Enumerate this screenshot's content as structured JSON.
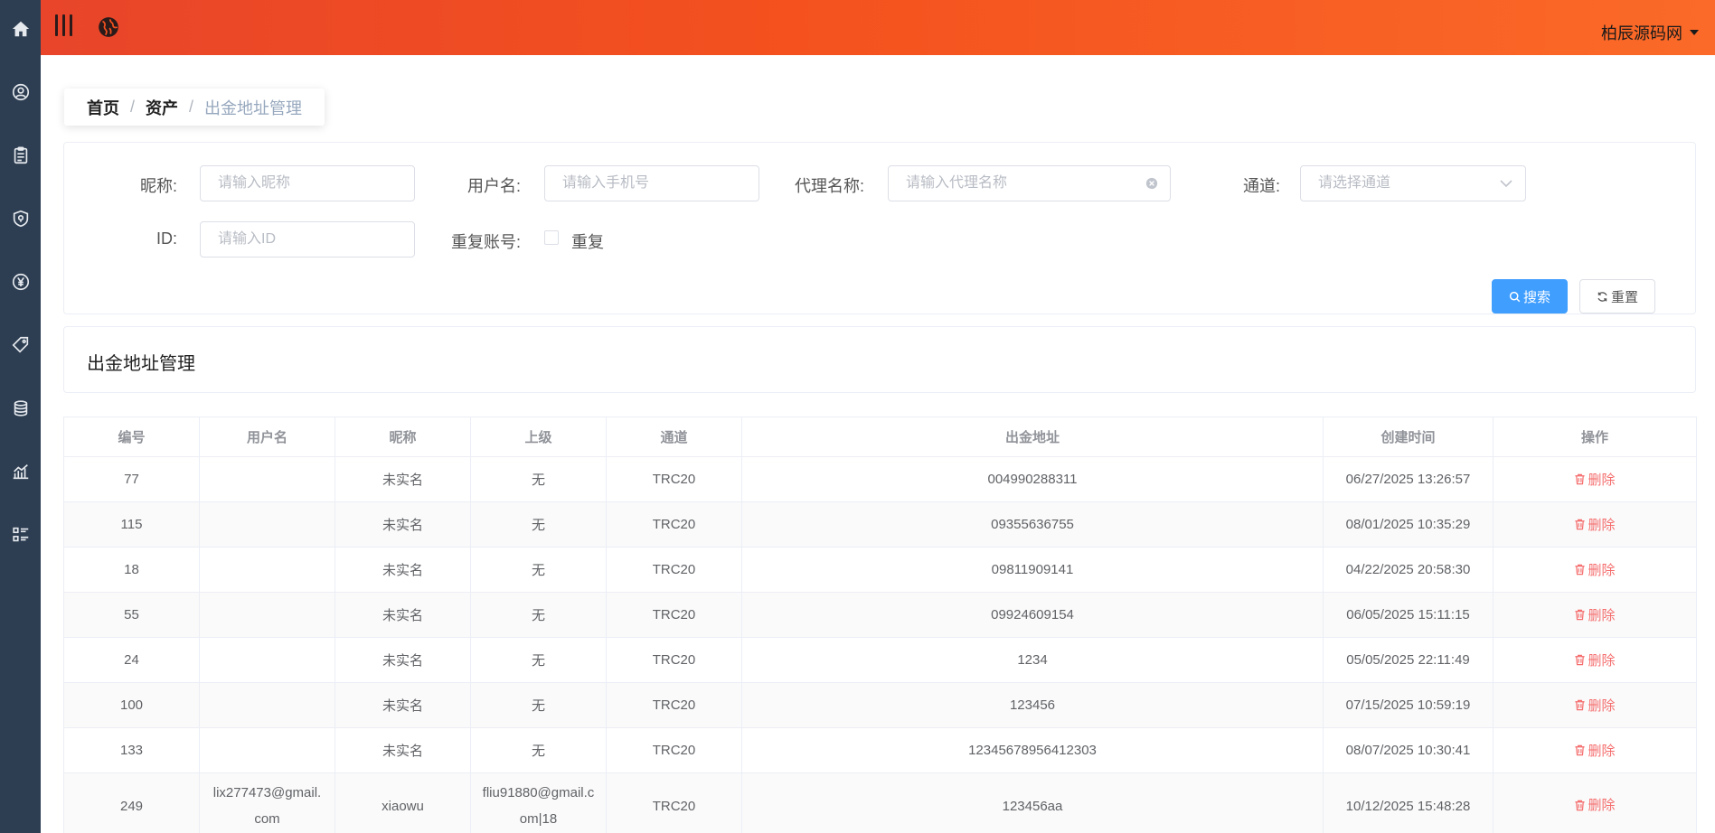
{
  "header": {
    "user_name": "柏辰源码网"
  },
  "breadcrumb": {
    "items": [
      "首页",
      "资产",
      "出金地址管理"
    ],
    "separator": "/"
  },
  "search": {
    "nickname": {
      "label": "昵称:",
      "placeholder": "请输入昵称"
    },
    "username": {
      "label": "用户名:",
      "placeholder": "请输入手机号"
    },
    "agent": {
      "label": "代理名称:",
      "placeholder": "请输入代理名称"
    },
    "channel": {
      "label": "通道:",
      "placeholder": "请选择通道"
    },
    "id": {
      "label": "ID:",
      "placeholder": "请输入ID"
    },
    "duplicate": {
      "label": "重复账号:",
      "checkbox_text": "重复"
    },
    "search_button": "搜索",
    "reset_button": "重置"
  },
  "panel_title": "出金地址管理",
  "table": {
    "columns": [
      "编号",
      "用户名",
      "昵称",
      "上级",
      "通道",
      "出金地址",
      "创建时间",
      "操作"
    ],
    "delete_label": "删除",
    "rows": [
      {
        "id": "77",
        "username": "",
        "nickname": "未实名",
        "parent": "无",
        "channel": "TRC20",
        "address": "004990288311",
        "created": "06/27/2025 13:26:57"
      },
      {
        "id": "115",
        "username": "",
        "nickname": "未实名",
        "parent": "无",
        "channel": "TRC20",
        "address": "09355636755",
        "created": "08/01/2025 10:35:29"
      },
      {
        "id": "18",
        "username": "",
        "nickname": "未实名",
        "parent": "无",
        "channel": "TRC20",
        "address": "09811909141",
        "created": "04/22/2025 20:58:30"
      },
      {
        "id": "55",
        "username": "",
        "nickname": "未实名",
        "parent": "无",
        "channel": "TRC20",
        "address": "09924609154",
        "created": "06/05/2025 15:11:15"
      },
      {
        "id": "24",
        "username": "",
        "nickname": "未实名",
        "parent": "无",
        "channel": "TRC20",
        "address": "1234",
        "created": "05/05/2025 22:11:49"
      },
      {
        "id": "100",
        "username": "",
        "nickname": "未实名",
        "parent": "无",
        "channel": "TRC20",
        "address": "123456",
        "created": "07/15/2025 10:59:19"
      },
      {
        "id": "133",
        "username": "",
        "nickname": "未实名",
        "parent": "无",
        "channel": "TRC20",
        "address": "12345678956412303",
        "created": "08/07/2025 10:30:41"
      },
      {
        "id": "249",
        "username": "lix277473@gmail.com",
        "nickname": "xiaowu",
        "parent": "fliu91880@gmail.com|18",
        "channel": "TRC20",
        "address": "123456aa",
        "created": "10/12/2025 15:48:28"
      }
    ]
  },
  "colors": {
    "sidebar_bg": "#2e3e52",
    "header_gradient_start": "#e8452a",
    "header_gradient_end": "#fb6a28",
    "primary": "#409eff",
    "danger": "#f56c6c",
    "link": "#1a1ad6"
  },
  "icons": {
    "sidebar": [
      "home-icon",
      "user-circle-icon",
      "clipboard-icon",
      "shield-icon",
      "yen-icon",
      "tag-icon",
      "coins-icon",
      "chart-icon",
      "list-icon"
    ],
    "header": [
      "hamburger-icon",
      "globe-icon",
      "caret-down-icon"
    ]
  }
}
